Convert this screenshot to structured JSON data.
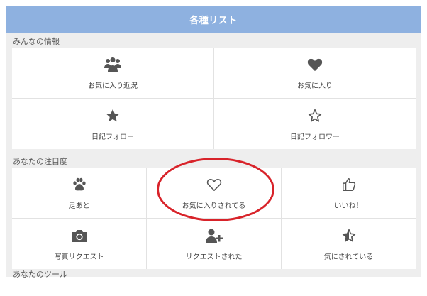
{
  "header": {
    "title": "各種リスト"
  },
  "sections": [
    {
      "title": "みんなの情報",
      "items": [
        {
          "label": "お気に入り近況",
          "icon": "group-icon"
        },
        {
          "label": "お気に入り",
          "icon": "heart-icon"
        },
        {
          "label": "日記フォロー",
          "icon": "star-icon"
        },
        {
          "label": "日記フォロワー",
          "icon": "star-outline-icon"
        }
      ]
    },
    {
      "title": "あなたの注目度",
      "items": [
        {
          "label": "足あと",
          "icon": "paw-icon"
        },
        {
          "label": "お気に入りされてる",
          "icon": "heart-outline-icon"
        },
        {
          "label": "いいね！",
          "icon": "thumbs-up-icon"
        },
        {
          "label": "写真リクエスト",
          "icon": "camera-icon"
        },
        {
          "label": "リクエストされた",
          "icon": "user-plus-icon"
        },
        {
          "label": "気にされている",
          "icon": "star-half-icon"
        }
      ]
    },
    {
      "title": "あなたのツール"
    }
  ],
  "colors": {
    "header": "#8eb1e0",
    "highlight": "#d8232a",
    "icon": "#555555"
  }
}
